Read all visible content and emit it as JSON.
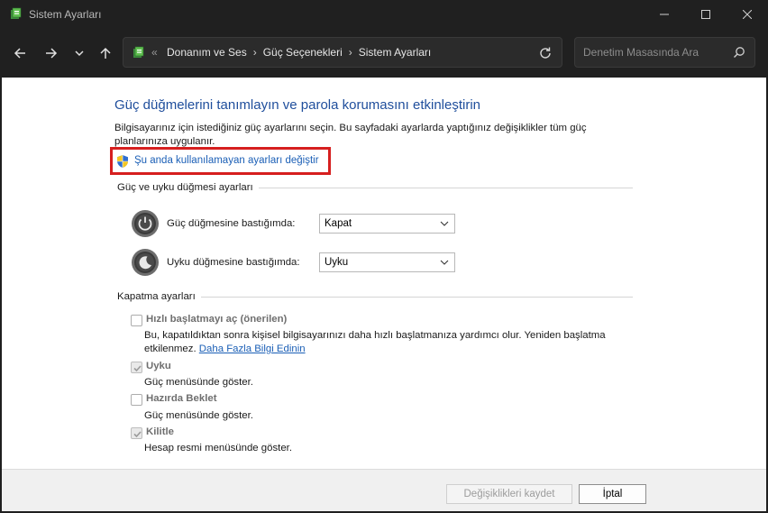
{
  "window": {
    "title": "Sistem Ayarları"
  },
  "nav": {
    "breadcrumbs": [
      "Donanım ve Ses",
      "Güç Seçenekleri",
      "Sistem Ayarları"
    ],
    "overflow_marker": "«",
    "search_placeholder": "Denetim Masasında Ara"
  },
  "main": {
    "heading": "Güç düğmelerini tanımlayın ve parola korumasını etkinleştirin",
    "description": "Bilgisayarınız için istediğiniz güç ayarlarını seçin. Bu sayfadaki ayarlarda yaptığınız değişiklikler tüm güç planlarınıza uygulanır.",
    "change_link": "Şu anda kullanılamayan ayarları değiştir",
    "power_group": {
      "title": "Güç ve uyku düğmesi ayarları",
      "rows": [
        {
          "label": "Güç düğmesine bastığımda:",
          "value": "Kapat"
        },
        {
          "label": "Uyku düğmesine bastığımda:",
          "value": "Uyku"
        }
      ]
    },
    "shutdown_group": {
      "title": "Kapatma ayarları",
      "items": [
        {
          "label": "Hızlı başlatmayı aç (önerilen)",
          "checked": false,
          "desc": "Bu, kapatıldıktan sonra kişisel bilgisayarınızı daha hızlı başlatmanıza yardımcı olur. Yeniden başlatma etkilenmez.",
          "link": "Daha Fazla Bilgi Edinin"
        },
        {
          "label": "Uyku",
          "checked": true,
          "desc": "Güç menüsünde göster."
        },
        {
          "label": "Hazırda Beklet",
          "checked": false,
          "desc": "Güç menüsünde göster."
        },
        {
          "label": "Kilitle",
          "checked": true,
          "desc": "Hesap resmi menüsünde göster."
        }
      ]
    }
  },
  "footer": {
    "save_label": "Değişiklikleri kaydet",
    "cancel_label": "İptal"
  },
  "colors": {
    "link": "#1b5fb6",
    "heading": "#1f4e9c",
    "highlight": "#d61f1f"
  }
}
